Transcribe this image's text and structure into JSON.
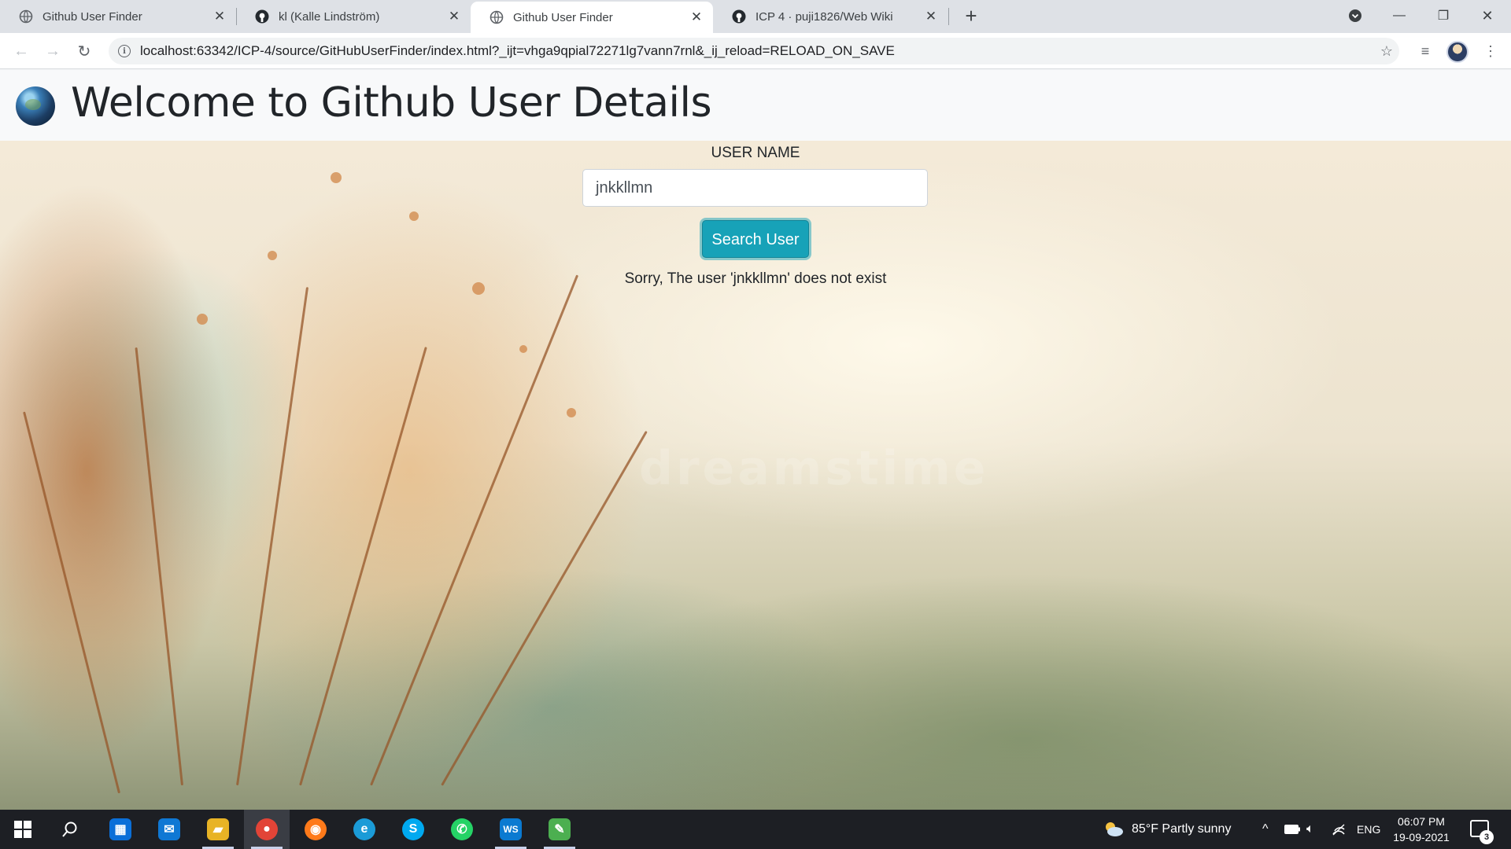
{
  "browser": {
    "tabs": [
      {
        "title": "Github User Finder",
        "icon": "globe-icon"
      },
      {
        "title": "kl (Kalle Lindström)",
        "icon": "github-icon"
      },
      {
        "title": "Github User Finder",
        "icon": "globe-icon",
        "active": true
      },
      {
        "title": "ICP 4 · puji1826/Web Wiki",
        "icon": "github-icon"
      }
    ],
    "url": "localhost:63342/ICP-4/source/GitHubUserFinder/index.html?_ijt=vhga9qpial72271lg7vann7rnl&_ij_reload=RELOAD_ON_SAVE"
  },
  "page": {
    "title": "Welcome to Github User Details",
    "form": {
      "label": "USER NAME",
      "input_value": "jnkkllmn",
      "button_label": "Search User",
      "message": "Sorry, The user 'jnkkllmn' does not exist"
    },
    "watermark": "dreamstime"
  },
  "taskbar": {
    "apps": [
      {
        "name": "store",
        "glyph": "▦",
        "color": "#0b6fd8"
      },
      {
        "name": "mail",
        "glyph": "✉",
        "color": "#0f78d4"
      },
      {
        "name": "file-explorer",
        "glyph": "▰",
        "color": "#e8b325"
      },
      {
        "name": "chrome",
        "glyph": "●",
        "color": "#e24437"
      },
      {
        "name": "firefox",
        "glyph": "◉",
        "color": "#ff7a1a"
      },
      {
        "name": "edge",
        "glyph": "e",
        "color": "#1b9bd7"
      },
      {
        "name": "skype",
        "glyph": "S",
        "color": "#00a9f0"
      },
      {
        "name": "whatsapp",
        "glyph": "✆",
        "color": "#25d366"
      },
      {
        "name": "webstorm",
        "glyph": "WS",
        "color": "#0b7ad1"
      },
      {
        "name": "paint",
        "glyph": "✎",
        "color": "#4caf50"
      }
    ],
    "weather": "85°F  Partly sunny",
    "language": "ENG",
    "time": "06:07 PM",
    "date": "19-09-2021",
    "notification_count": "3"
  },
  "colors": {
    "accent": "#17a2b8",
    "header_bg": "#f8f9fa",
    "taskbar_bg": "#1d1f24"
  }
}
